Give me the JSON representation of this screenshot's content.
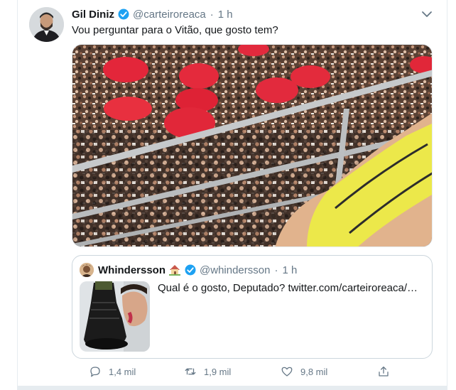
{
  "tweet": {
    "author_name": "Gil Diniz",
    "author_handle": "@carteiroreaca",
    "separator": "·",
    "time": "1 h",
    "text": "Vou perguntar para o Vitão, que gosto tem?",
    "verified_icon": "verified-badge-icon",
    "menu_icon": "chevron-down-icon"
  },
  "quoted": {
    "author_name": "Whindersson",
    "emoji": "house-emoji-icon",
    "author_handle": "@whindersson",
    "separator": "·",
    "time": "1 h",
    "text": "Qual é o gosto, Deputado?  twitter.com/carteiroreaca/…"
  },
  "actions": {
    "reply_count": "1,4 mil",
    "retweet_count": "1,9 mil",
    "like_count": "9,8 mil",
    "share_icon": "share-icon"
  },
  "colors": {
    "accent": "#1da1f2",
    "text_primary": "#14171a",
    "text_secondary": "#657786",
    "border": "#e6ecf0"
  }
}
